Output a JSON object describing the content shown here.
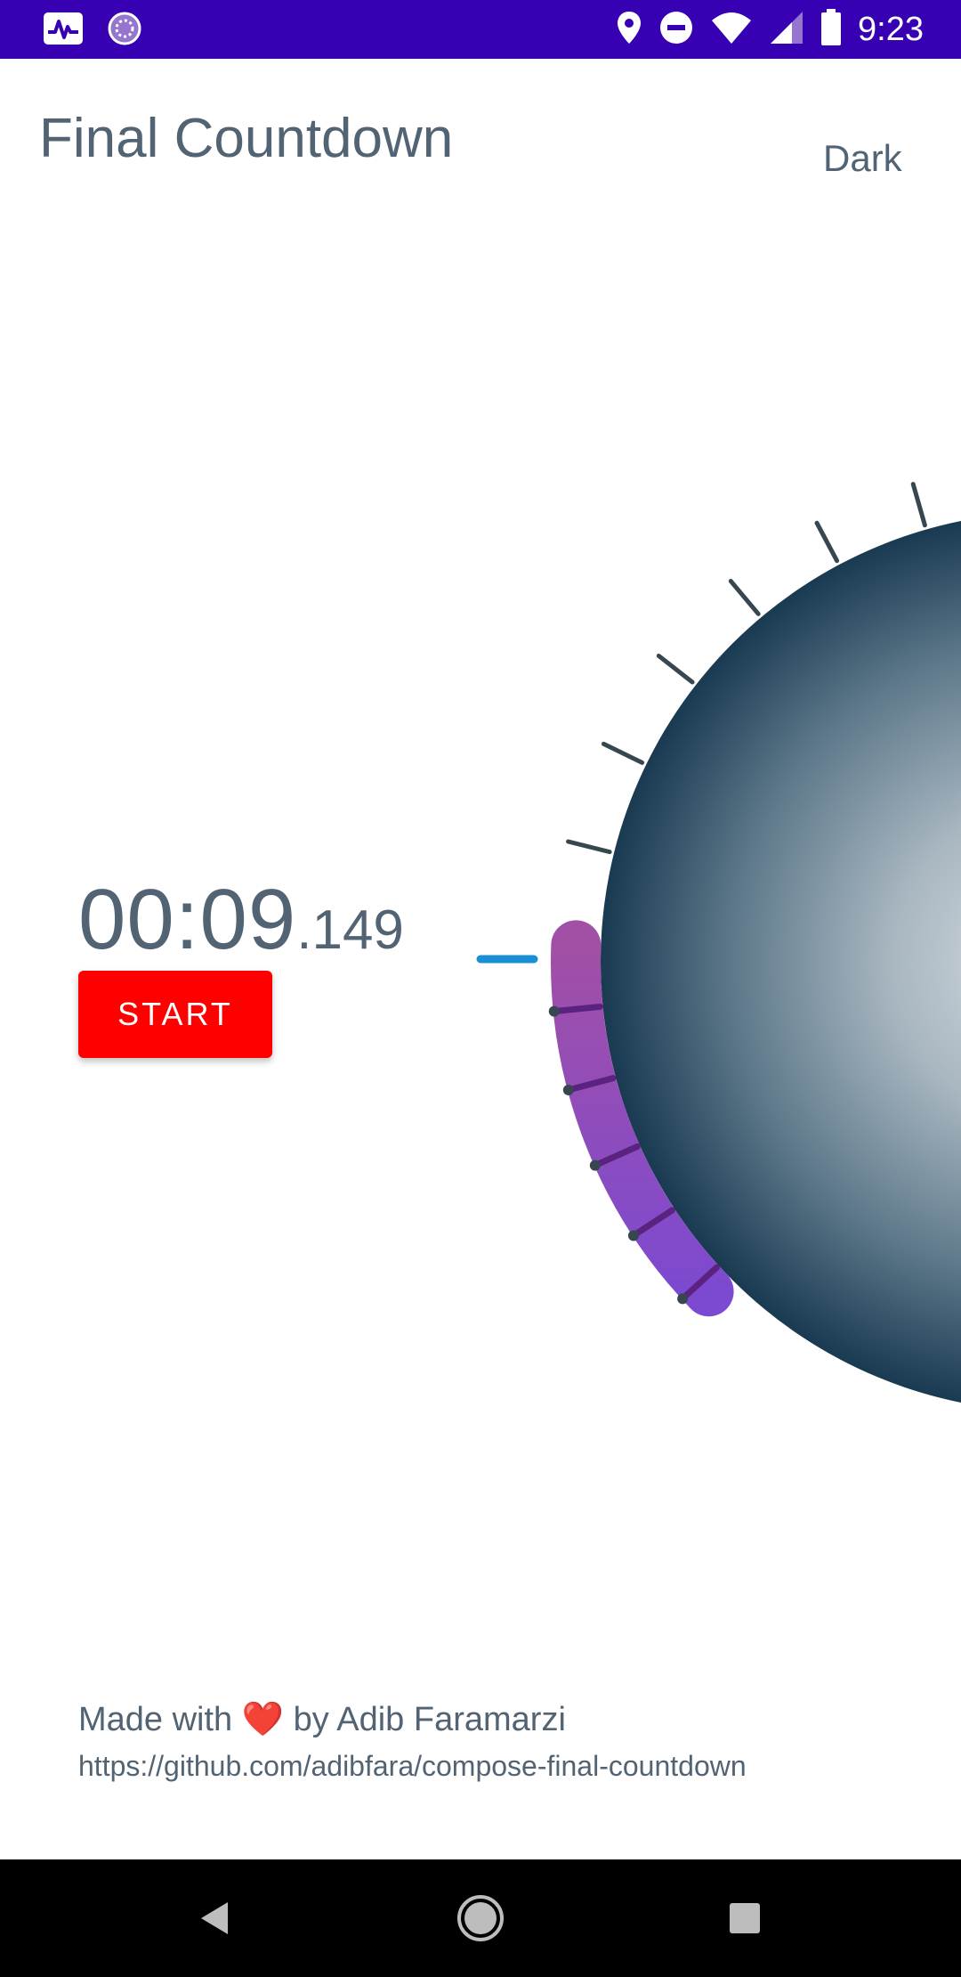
{
  "status_bar": {
    "time": "9:23",
    "left_icons": [
      "activity-icon",
      "sync-icon"
    ],
    "right_icons": [
      "location-icon",
      "do-not-disturb-icon",
      "wifi-icon",
      "signal-icon",
      "battery-icon"
    ]
  },
  "app": {
    "title": "Final Countdown",
    "theme_toggle_label": "Dark"
  },
  "timer": {
    "main": "00:09",
    "milliseconds": ".149",
    "start_label": "START"
  },
  "dial": {
    "progress_fraction": 0.2,
    "colors": {
      "arc_start": "#a24fa6",
      "arc_end": "#7c4ad0",
      "sphere_center": "#d6dde2",
      "sphere_edge": "#193a51",
      "tick": "#37474f",
      "marker": "#1b8fd6"
    }
  },
  "footer": {
    "credit_prefix": "Made with",
    "heart": "❤️",
    "credit_suffix": "by Adib Faramarzi",
    "link": "https://github.com/adibfara/compose-final-countdown"
  },
  "nav_bar": {
    "buttons": [
      "back-icon",
      "home-icon",
      "recents-icon"
    ]
  },
  "colors": {
    "status_bar": "#3700b3",
    "text": "#526373",
    "start_button": "#ff0000",
    "nav_bar": "#000000"
  }
}
